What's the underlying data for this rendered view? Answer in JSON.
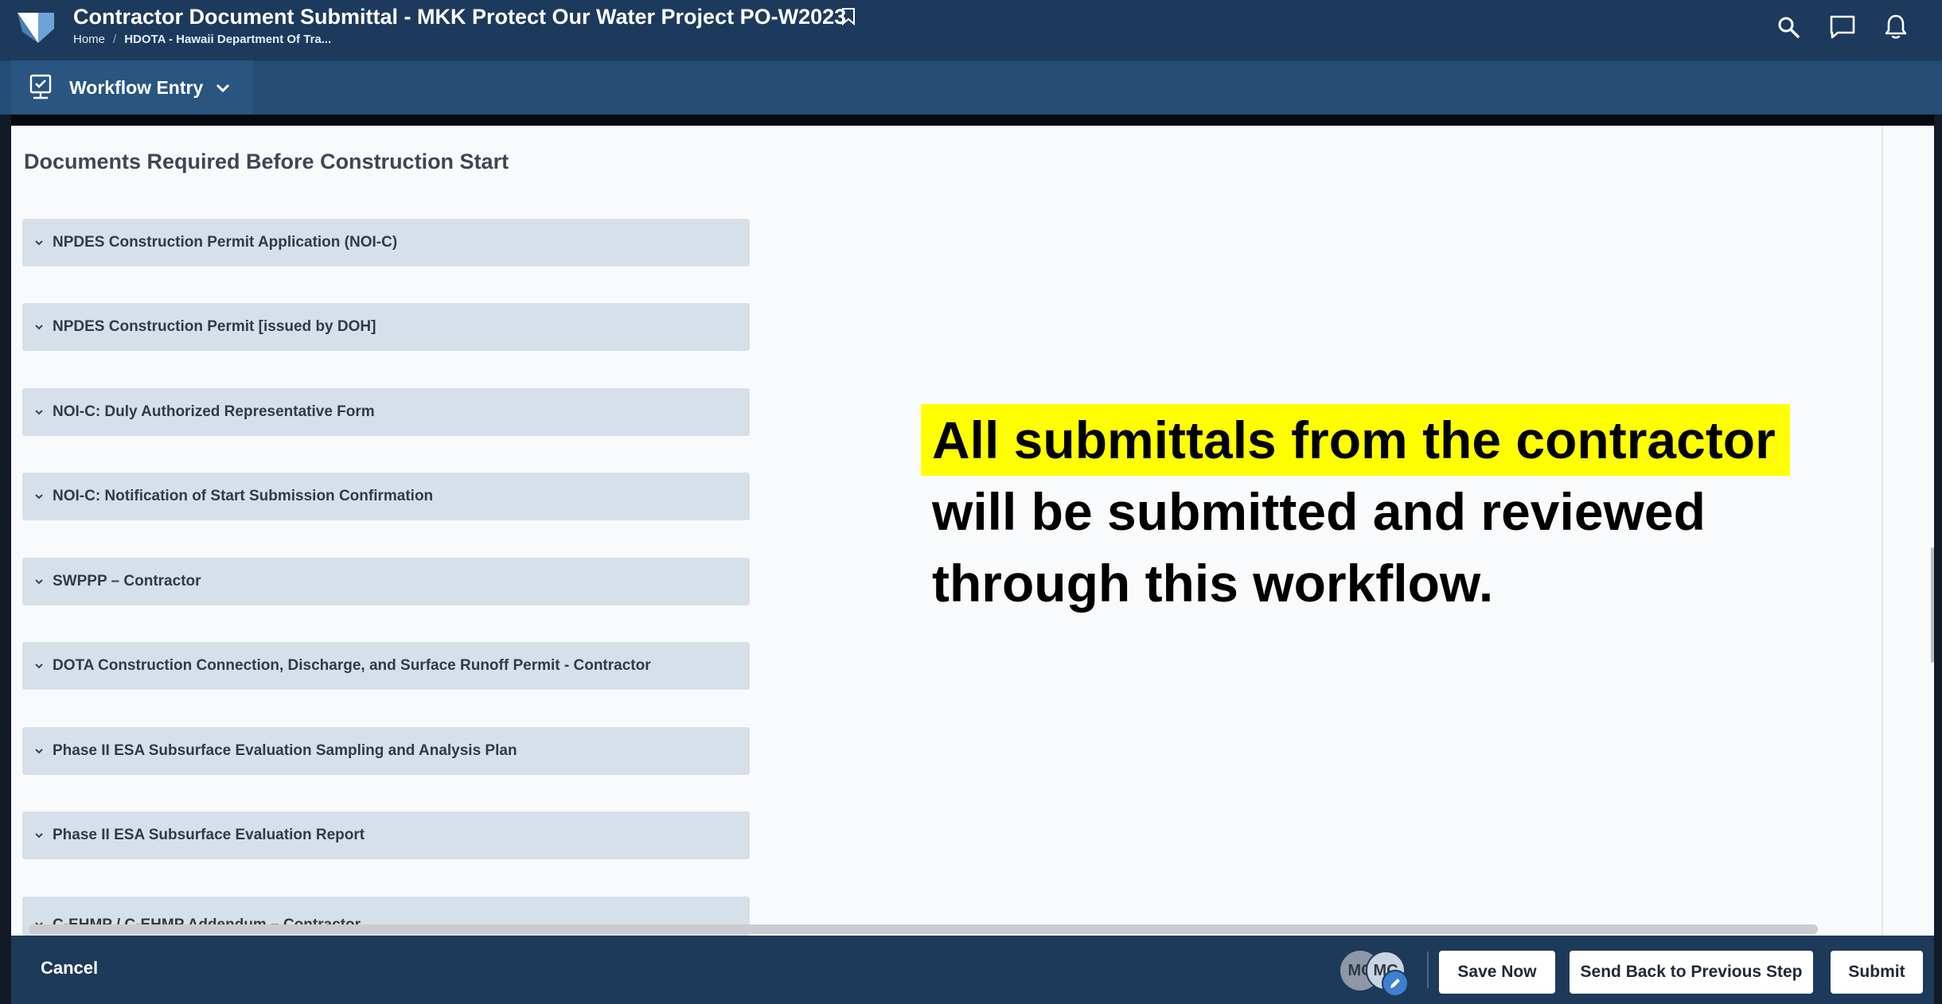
{
  "header": {
    "title": "Contractor Document Submittal - MKK Protect Our Water Project PO-W2023",
    "breadcrumb": {
      "home": "Home",
      "current": "HDOTA - Hawaii Department Of Tra..."
    },
    "icons": [
      "search-icon",
      "message-icon",
      "bell-icon",
      "bookmark-icon"
    ]
  },
  "nav": {
    "workflow_label": "Workflow Entry"
  },
  "main": {
    "section_title": "Documents Required Before Construction Start",
    "accordion_items": [
      {
        "label": "NPDES Construction Permit Application (NOI-C)"
      },
      {
        "label": "NPDES Construction Permit [issued by DOH]"
      },
      {
        "label": "NOI-C: Duly Authorized Representative Form"
      },
      {
        "label": "NOI-C: Notification of Start Submission Confirmation"
      },
      {
        "label": "SWPPP – Contractor"
      },
      {
        "label": "DOTA Construction Connection, Discharge, and Surface Runoff Permit - Contractor"
      },
      {
        "label": "Phase II ESA Subsurface Evaluation Sampling and Analysis Plan"
      },
      {
        "label": "Phase II ESA Subsurface Evaluation Report"
      },
      {
        "label": "C-EHMP / C-EHMP Addendum – Contractor"
      }
    ]
  },
  "annotation": {
    "highlighted": "All submittals from the contractor",
    "line2": "will be submitted and reviewed",
    "line3": "through this workflow.",
    "highlight_color": "#ffff00"
  },
  "footer": {
    "cancel_label": "Cancel",
    "avatars": [
      "MC",
      "MC"
    ],
    "save_label": "Save Now",
    "send_back_label": "Send Back to Previous Step",
    "submit_label": "Submit"
  },
  "colors": {
    "header_bg": "#1d3a5c",
    "nav_bg": "#234b73",
    "accordion_bg": "#d6e0eb",
    "footer_bg": "#1e3a5a"
  }
}
